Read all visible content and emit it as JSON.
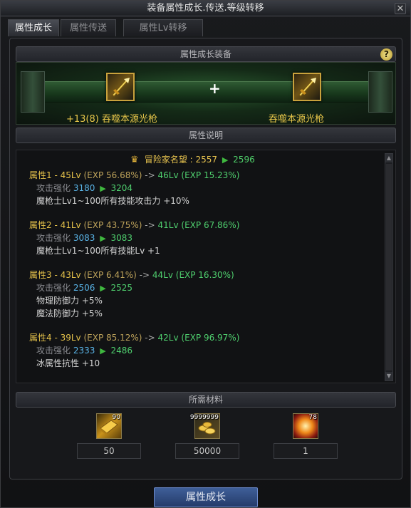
{
  "window": {
    "title": "装备属性成长.传送.等级转移",
    "close_symbol": "✕"
  },
  "tabs": [
    {
      "label": "属性成长",
      "active": true
    },
    {
      "label": "属性传送",
      "active": false
    },
    {
      "label": "属性Lv转移",
      "active": false
    }
  ],
  "equip_section": {
    "header": "属性成长装备",
    "help_symbol": "?",
    "plus": "+",
    "source_item": {
      "name": "+13(8) 吞噬本源光枪",
      "icon": "golden-spear-icon"
    },
    "target_item": {
      "name": "吞噬本源光枪",
      "icon": "golden-spear-icon"
    }
  },
  "desc_section": {
    "header": "属性说明",
    "fame": {
      "label": "冒险家名望 : 2557",
      "new_value": "2596"
    },
    "attributes": [
      {
        "title": "属性1 - 45Lv",
        "exp_old": "(EXP 56.68%)",
        "arrow": "->",
        "new_level": "46Lv",
        "exp_new": "(EXP 15.23%)",
        "stat_name": "攻击强化",
        "stat_old": "3180",
        "stat_new": "3204",
        "effects": [
          "魔枪士Lv1~100所有技能攻击力 +10%"
        ]
      },
      {
        "title": "属性2 - 41Lv",
        "exp_old": "(EXP 43.75%)",
        "arrow": "->",
        "new_level": "41Lv",
        "exp_new": "(EXP 67.86%)",
        "stat_name": "攻击强化",
        "stat_old": "3083",
        "stat_new": "3083",
        "effects": [
          "魔枪士Lv1~100所有技能Lv +1"
        ]
      },
      {
        "title": "属性3 - 43Lv",
        "exp_old": "(EXP 6.41%)",
        "arrow": "->",
        "new_level": "44Lv",
        "exp_new": "(EXP 16.30%)",
        "stat_name": "攻击强化",
        "stat_old": "2506",
        "stat_new": "2525",
        "effects": [
          "物理防御力 +5%",
          "魔法防御力 +5%"
        ]
      },
      {
        "title": "属性4 - 39Lv",
        "exp_old": "(EXP 85.12%)",
        "arrow": "->",
        "new_level": "42Lv",
        "exp_new": "(EXP 96.97%)",
        "stat_name": "攻击强化",
        "stat_old": "2333",
        "stat_new": "2486",
        "effects": [
          "冰属性抗性 +10"
        ]
      }
    ]
  },
  "materials_section": {
    "header": "所需材料",
    "items": [
      {
        "icon": "gold-block-icon",
        "badge": "90",
        "count": "50"
      },
      {
        "icon": "gold-coins-icon",
        "badge": "9999999",
        "count": "50000"
      },
      {
        "icon": "flame-orb-icon",
        "badge": "78",
        "count": "1"
      }
    ]
  },
  "action_button": {
    "label": "属性成长"
  }
}
